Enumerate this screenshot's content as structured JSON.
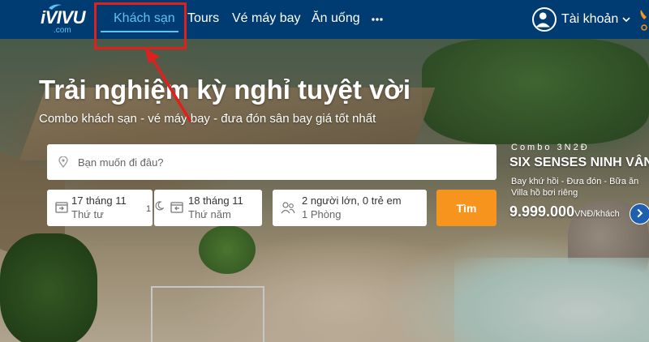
{
  "brand": {
    "logo_main": "iVIVU",
    "logo_sub": ".com"
  },
  "nav": {
    "items": [
      {
        "label": "Khách sạn",
        "active": true
      },
      {
        "label": "Tours"
      },
      {
        "label": "Vé máy bay"
      },
      {
        "label": "Ăn uống"
      }
    ],
    "more_icon": "more-dots-icon",
    "account_label": "Tài khoản"
  },
  "hero": {
    "headline": "Trải nghiệm kỳ nghỉ tuyệt vời",
    "subline": "Combo khách sạn - vé máy bay - đưa đón sân bay giá tốt nhất"
  },
  "search": {
    "placeholder": "Bạn muốn đi đâu?",
    "checkin": {
      "day": "17 tháng 11",
      "weekday": "Thứ tư"
    },
    "checkout": {
      "day": "18 tháng 11",
      "weekday": "Thứ năm"
    },
    "nights": "1",
    "guests": {
      "line1": "2 người lớn, 0 trẻ em",
      "line2": "1 Phòng"
    },
    "button_label": "Tìm"
  },
  "promo": {
    "kicker": "Combo 3N2Đ",
    "title": "SIX SENSES NINH VÂN",
    "desc_line1": "Bay khứ hồi - Đưa đón - Bữa ăn",
    "desc_line2": "Villa hồ bơi riêng",
    "price": "9.999.000",
    "unit": "VNĐ/khách"
  },
  "colors": {
    "header": "#003c71",
    "accent": "#5fc3f0",
    "cta": "#f7941d",
    "annotation": "#e0201c"
  }
}
